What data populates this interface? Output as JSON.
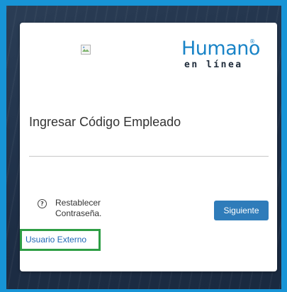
{
  "login": {
    "logo": {
      "main": "Humano",
      "registered": "®",
      "sub": "en línea"
    },
    "employee_code_field": {
      "placeholder": "Ingresar Código Empleado",
      "value": ""
    },
    "reset_password": {
      "icon_glyph": "?",
      "line1": "Restablecer",
      "line2": "Contraseña."
    },
    "next_button": "Siguiente",
    "external_user_link": "Usuario Externo"
  },
  "colors": {
    "frame": "#1794d6",
    "primary_button": "#2f7cba",
    "logo_blue": "#1a84c7",
    "highlight_box": "#2e9e45",
    "link": "#1f67b5"
  },
  "icons": {
    "broken_image": "broken-image-icon",
    "help": "help-circle-icon"
  }
}
